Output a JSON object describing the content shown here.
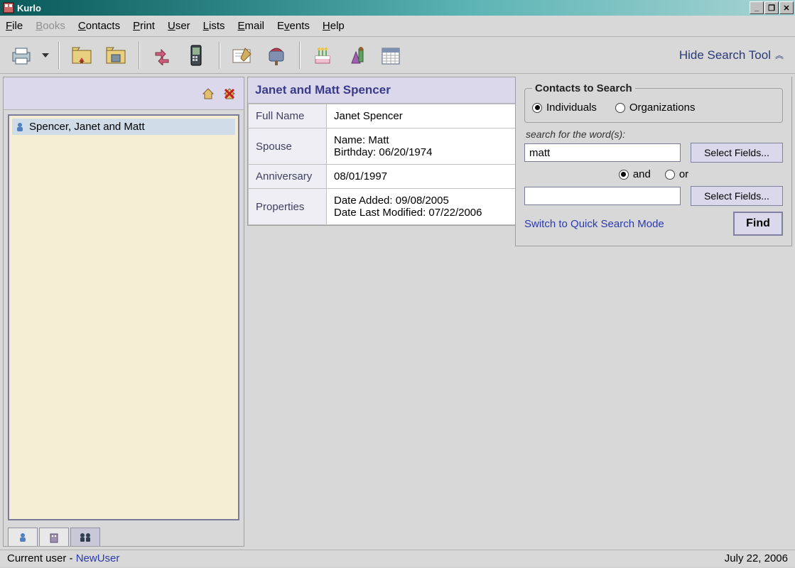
{
  "window": {
    "title": "Kurlo"
  },
  "menu": {
    "file": "File",
    "books": "Books",
    "contacts": "Contacts",
    "print": "Print",
    "user": "User",
    "lists": "Lists",
    "email": "Email",
    "events": "Events",
    "help": "Help"
  },
  "toolbar": {
    "hide_search": "Hide Search Tool"
  },
  "contact_list": {
    "items": [
      "Spencer, Janet and Matt"
    ]
  },
  "detail": {
    "title": "Janet and Matt Spencer",
    "rows": {
      "full_name_label": "Full Name",
      "full_name_value": "Janet Spencer",
      "spouse_label": "Spouse",
      "spouse_name_label": "Name:",
      "spouse_name_value": "Matt",
      "spouse_bday_label": "Birthday:",
      "spouse_bday_value": "06/20/1974",
      "anniversary_label": "Anniversary",
      "anniversary_value": "08/01/1997",
      "properties_label": "Properties",
      "date_added_label": "Date Added:",
      "date_added_value": "09/08/2005",
      "date_modified_label": "Date Last Modified:",
      "date_modified_value": "07/22/2006"
    }
  },
  "search": {
    "group_title": "Contacts to Search",
    "individuals": "Individuals",
    "organizations": "Organizations",
    "search_for_label": "search for the word(s):",
    "word1": "matt",
    "word2": "",
    "select_fields": "Select Fields...",
    "and": "and",
    "or": "or",
    "switch_mode": "Switch to Quick Search Mode",
    "find": "Find"
  },
  "status": {
    "prefix": "Current user - ",
    "user": "NewUser",
    "date": "July 22, 2006"
  }
}
